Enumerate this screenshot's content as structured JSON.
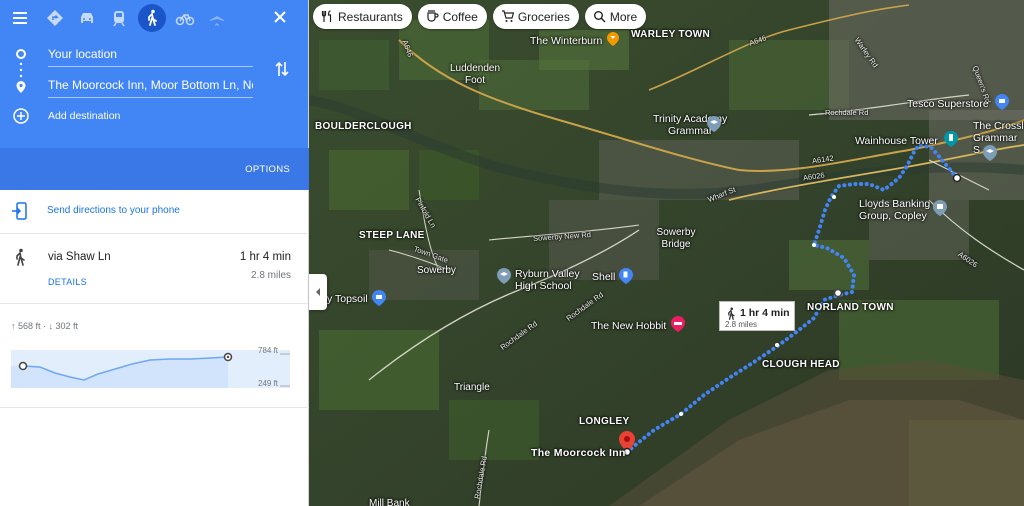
{
  "panel": {
    "travel_modes": [
      {
        "name": "best",
        "icon": "directions-diamond-icon"
      },
      {
        "name": "driving",
        "icon": "car-icon"
      },
      {
        "name": "transit",
        "icon": "train-icon"
      },
      {
        "name": "walking",
        "icon": "walk-icon",
        "active": true
      },
      {
        "name": "cycling",
        "icon": "bike-icon"
      },
      {
        "name": "flights",
        "icon": "plane-icon"
      }
    ],
    "origin": "Your location",
    "destination": "The Moorcock Inn, Moor Bottom Ln, Norland",
    "add_destination": "Add destination",
    "options_label": "OPTIONS",
    "send_directions": "Send directions to your phone",
    "route": {
      "via": "via Shaw Ln",
      "duration": "1 hr 4 min",
      "distance": "2.8 miles",
      "details_label": "DETAILS"
    },
    "elevation": {
      "summary": "↑ 568 ft · ↓ 302 ft",
      "max_label": "784 ft",
      "min_label": "249 ft"
    }
  },
  "map": {
    "chips": [
      {
        "label": "Restaurants",
        "icon": "cutlery-icon"
      },
      {
        "label": "Coffee",
        "icon": "coffee-icon"
      },
      {
        "label": "Groceries",
        "icon": "cart-icon"
      },
      {
        "label": "More",
        "icon": "search-icon"
      }
    ],
    "places": {
      "warley_town": "WARLEY TOWN",
      "boulderclough": "BOULDERCLOUGH",
      "steep_lane": "STEEP LANE",
      "norland_town": "NORLAND TOWN",
      "clough_head": "CLOUGH HEAD",
      "longley": "LONGLEY",
      "luddenden_foot": "Luddenden\nFoot",
      "sowerby": "Sowerby",
      "sowerby_bridge": "Sowerby\nBridge",
      "triangle": "Triangle",
      "mill_bank": "Mill Bank"
    },
    "pois": {
      "winterburn": "The Winterburn",
      "trinity": "Trinity Academy\nGrammar",
      "tesco": "Tesco Superstore",
      "wainhouse": "Wainhouse Tower",
      "crossley": "The Crossl\nGrammar S",
      "lloyds": "Lloyds Banking\nGroup, Copley",
      "ryburn": "Ryburn Valley\nHigh School",
      "shell": "Shell",
      "new_hobbit": "The New Hobbit",
      "topsoil": "y Topsoil",
      "moorcock": "The Moorcock Inn"
    },
    "roads": {
      "a646_w": "A646",
      "a646_n": "A646",
      "warley_rd": "Warley Rd",
      "queens_rd": "Queen's Rd",
      "rochdale_rd_ne": "Rochdale Rd",
      "a6142": "A6142",
      "a6026_n": "A6026",
      "a6026_s": "A6026",
      "wharf_st": "Wharf St",
      "sowerby_new_rd": "Sowerby New Rd",
      "pinfold_ln": "Pinfold Ln",
      "town_gate": "Town Gate",
      "rochdale_rd_1": "Rochdale Rd",
      "rochdale_rd_2": "Rochdale Rd",
      "rochdale_rd_3": "Rochdale Rd"
    },
    "route_card": {
      "duration": "1 hr 4 min",
      "distance": "2.8 miles"
    },
    "colors": {
      "route": "#4285f4",
      "panel_blue": "#4285f4",
      "destination_pin": "#ea4335"
    }
  }
}
